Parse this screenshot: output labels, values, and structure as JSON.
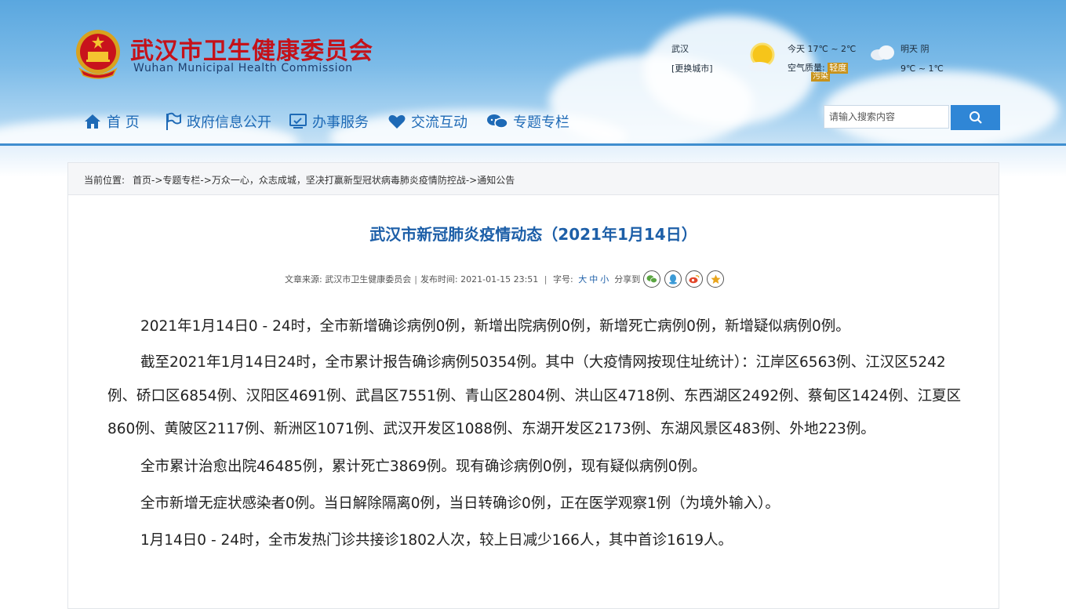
{
  "header": {
    "site_name_cn": "武汉市卫生健康委员会",
    "site_name_en": "Wuhan Municipal Health Commission"
  },
  "weather": {
    "city": "武汉",
    "change_city": "[更换城市]",
    "today": "今天  17℃ ~ 2℃",
    "air_quality_label": "空气质量:",
    "air_quality_value_1": "轻度",
    "air_quality_value_2": "污染",
    "tomorrow": "明天  阴",
    "tomorrow_temp": "9℃ ~ 1℃"
  },
  "nav": {
    "items": [
      {
        "label": "首 页",
        "icon": "home-icon"
      },
      {
        "label": "政府信息公开",
        "icon": "flag-icon"
      },
      {
        "label": "办事服务",
        "icon": "monitor-icon"
      },
      {
        "label": "交流互动",
        "icon": "heart-icon"
      },
      {
        "label": "专题专栏",
        "icon": "chat-icon"
      }
    ]
  },
  "search": {
    "placeholder": "请输入搜索内容",
    "icon": "search-icon"
  },
  "breadcrumb": {
    "label": "当前位置:",
    "path": "首页->专题专栏->万众一心，众志成城，坚决打赢新型冠状病毒肺炎疫情防控战->通知公告"
  },
  "article": {
    "title": "武汉市新冠肺炎疫情动态（2021年1月14日）",
    "source_label": "文章来源:",
    "source": "武汉市卫生健康委员会",
    "publish_label": "发布时间:",
    "publish_time": "2021-01-15 23:51",
    "font_size_label": "字号:",
    "font_large": "大",
    "font_medium": "中",
    "font_small": "小",
    "share_label": "分享到",
    "paragraphs": [
      "2021年1月14日0 - 24时，全市新增确诊病例0例，新增出院病例0例，新增死亡病例0例，新增疑似病例0例。",
      "截至2021年1月14日24时，全市累计报告确诊病例50354例。其中（大疫情网按现住址统计）：江岸区6563例、江汉区5242例、硚口区6854例、汉阳区4691例、武昌区7551例、青山区2804例、洪山区4718例、东西湖区2492例、蔡甸区1424例、江夏区860例、黄陂区2117例、新洲区1071例、武汉开发区1088例、东湖开发区2173例、东湖风景区483例、外地223例。",
      "全市累计治愈出院46485例，累计死亡3869例。现有确诊病例0例，现有疑似病例0例。",
      "全市新增无症状感染者0例。当日解除隔离0例，当日转确诊0例，正在医学观察1例（为境外输入）。",
      "1月14日0 - 24时，全市发热门诊共接诊1802人次，较上日减少166人，其中首诊1619人。"
    ]
  }
}
